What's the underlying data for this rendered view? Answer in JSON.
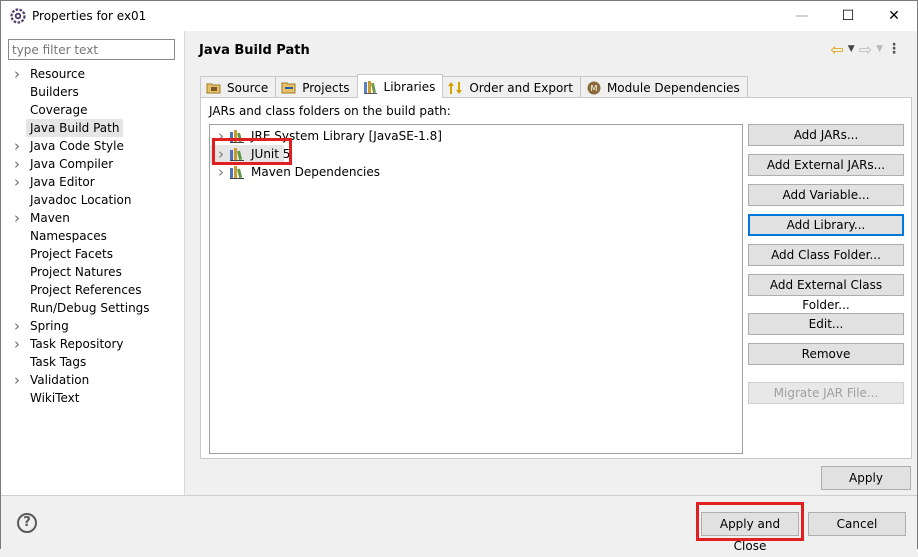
{
  "window": {
    "title": "Properties for ex01",
    "minimize_glyph": "—",
    "maximize_glyph": "☐",
    "close_glyph": "✕"
  },
  "filter": {
    "placeholder": "type filter text"
  },
  "nav_tree": [
    {
      "label": "Resource",
      "expandable": true
    },
    {
      "label": "Builders",
      "expandable": false
    },
    {
      "label": "Coverage",
      "expandable": false
    },
    {
      "label": "Java Build Path",
      "expandable": false,
      "selected": true
    },
    {
      "label": "Java Code Style",
      "expandable": true
    },
    {
      "label": "Java Compiler",
      "expandable": true
    },
    {
      "label": "Java Editor",
      "expandable": true
    },
    {
      "label": "Javadoc Location",
      "expandable": false
    },
    {
      "label": "Maven",
      "expandable": true
    },
    {
      "label": "Namespaces",
      "expandable": false
    },
    {
      "label": "Project Facets",
      "expandable": false
    },
    {
      "label": "Project Natures",
      "expandable": false
    },
    {
      "label": "Project References",
      "expandable": false
    },
    {
      "label": "Run/Debug Settings",
      "expandable": false
    },
    {
      "label": "Spring",
      "expandable": true
    },
    {
      "label": "Task Repository",
      "expandable": true
    },
    {
      "label": "Task Tags",
      "expandable": false
    },
    {
      "label": "Validation",
      "expandable": true
    },
    {
      "label": "WikiText",
      "expandable": false
    }
  ],
  "page": {
    "title": "Java Build Path"
  },
  "tabs": [
    {
      "label": "Source",
      "icon": "source-folder-icon"
    },
    {
      "label": "Projects",
      "icon": "projects-icon"
    },
    {
      "label": "Libraries",
      "icon": "libraries-icon",
      "active": true
    },
    {
      "label": "Order and Export",
      "icon": "order-export-icon"
    },
    {
      "label": "Module Dependencies",
      "icon": "module-icon"
    }
  ],
  "libraries_panel": {
    "description": "JARs and class folders on the build path:",
    "entries": [
      {
        "label": "JRE System Library [JavaSE-1.8]"
      },
      {
        "label": "JUnit 5",
        "selected": true
      },
      {
        "label": "Maven Dependencies"
      }
    ],
    "buttons": {
      "add_jars": "Add JARs...",
      "add_external_jars": "Add External JARs...",
      "add_variable": "Add Variable...",
      "add_library": "Add Library...",
      "add_class_folder": "Add Class Folder...",
      "add_external_class_folder": "Add External Class Folder...",
      "edit": "Edit...",
      "remove": "Remove",
      "migrate_jar": "Migrate JAR File..."
    }
  },
  "apply": "Apply",
  "footer": {
    "help_glyph": "?",
    "apply_and_close": "Apply and Close",
    "cancel": "Cancel"
  },
  "colors": {
    "highlight": "#e02020",
    "focus_border": "#0078d7",
    "selection_bg": "#e5e5e5"
  }
}
